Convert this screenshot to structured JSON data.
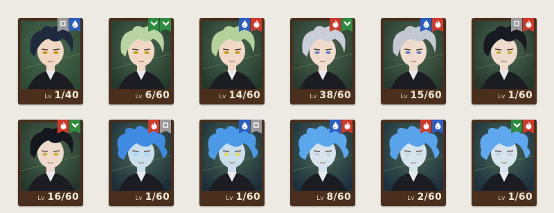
{
  "lv_prefix": "Lv",
  "colors": {
    "red": "#d1392b",
    "green": "#2e8b3e",
    "blue": "#2a5ec4",
    "gray": "#9a9a9a",
    "frame": "#4a2f1c"
  },
  "cards": [
    {
      "level": "1/40",
      "badges": [
        "gray",
        "blue"
      ],
      "hair": "#1f2a3f",
      "skin": "#f2d7c2",
      "bg": "#2b4a33",
      "eyes": "#c99a2a"
    },
    {
      "level": "6/60",
      "badges": [
        "green",
        "green"
      ],
      "hair": "#b9d4a2",
      "skin": "#f2d9c6",
      "bg": "#23382b",
      "eyes": "#c6a42a"
    },
    {
      "level": "14/60",
      "badges": [
        "blue",
        "red"
      ],
      "hair": "#b2d19b",
      "skin": "#f2d9c6",
      "bg": "#23382b",
      "eyes": "#c6a42a"
    },
    {
      "level": "38/60",
      "badges": [
        "red",
        "green"
      ],
      "hair": "#c9ced8",
      "skin": "#f0dccc",
      "bg": "#27382c",
      "eyes": "#7a86c6"
    },
    {
      "level": "15/60",
      "badges": [
        "blue",
        "red"
      ],
      "hair": "#c4c8d3",
      "skin": "#f0dccc",
      "bg": "#27382c",
      "eyes": "#7a86c6"
    },
    {
      "level": "1/60",
      "badges": [
        "gray",
        "red"
      ],
      "hair": "#181a22",
      "skin": "#eedbcb",
      "bg": "#24352a",
      "eyes": "#c8b24a"
    },
    {
      "level": "16/60",
      "badges": [
        "red",
        "green"
      ],
      "hair": "#15171f",
      "skin": "#eedbcb",
      "bg": "#24352a",
      "eyes": "#c8b24a"
    },
    {
      "level": "1/60",
      "badges": [
        "red",
        "gray"
      ],
      "hair": "#3f8be3",
      "skin": "#c9ddea",
      "bg": "#1a2d3b",
      "eyes": "#9fd8ff"
    },
    {
      "level": "1/60",
      "badges": [
        "blue",
        "gray"
      ],
      "hair": "#4a9ae8",
      "skin": "#c9ddea",
      "bg": "#1a2d3b",
      "eyes": "#e7d84e"
    },
    {
      "level": "8/60",
      "badges": [
        "blue",
        "red"
      ],
      "hair": "#5aa7ee",
      "skin": "#d7e3ea",
      "bg": "#1b2f3f",
      "eyes": "#c8d0dd"
    },
    {
      "level": "2/60",
      "badges": [
        "red",
        "blue"
      ],
      "hair": "#58a3ec",
      "skin": "#d7e3ea",
      "bg": "#1b2f3f",
      "eyes": "#c8d0dd"
    },
    {
      "level": "1/60",
      "badges": [
        "green",
        "red"
      ],
      "hair": "#5fa8ef",
      "skin": "#d7e3ea",
      "bg": "#1b2f3f",
      "eyes": "#c8d0dd"
    }
  ]
}
